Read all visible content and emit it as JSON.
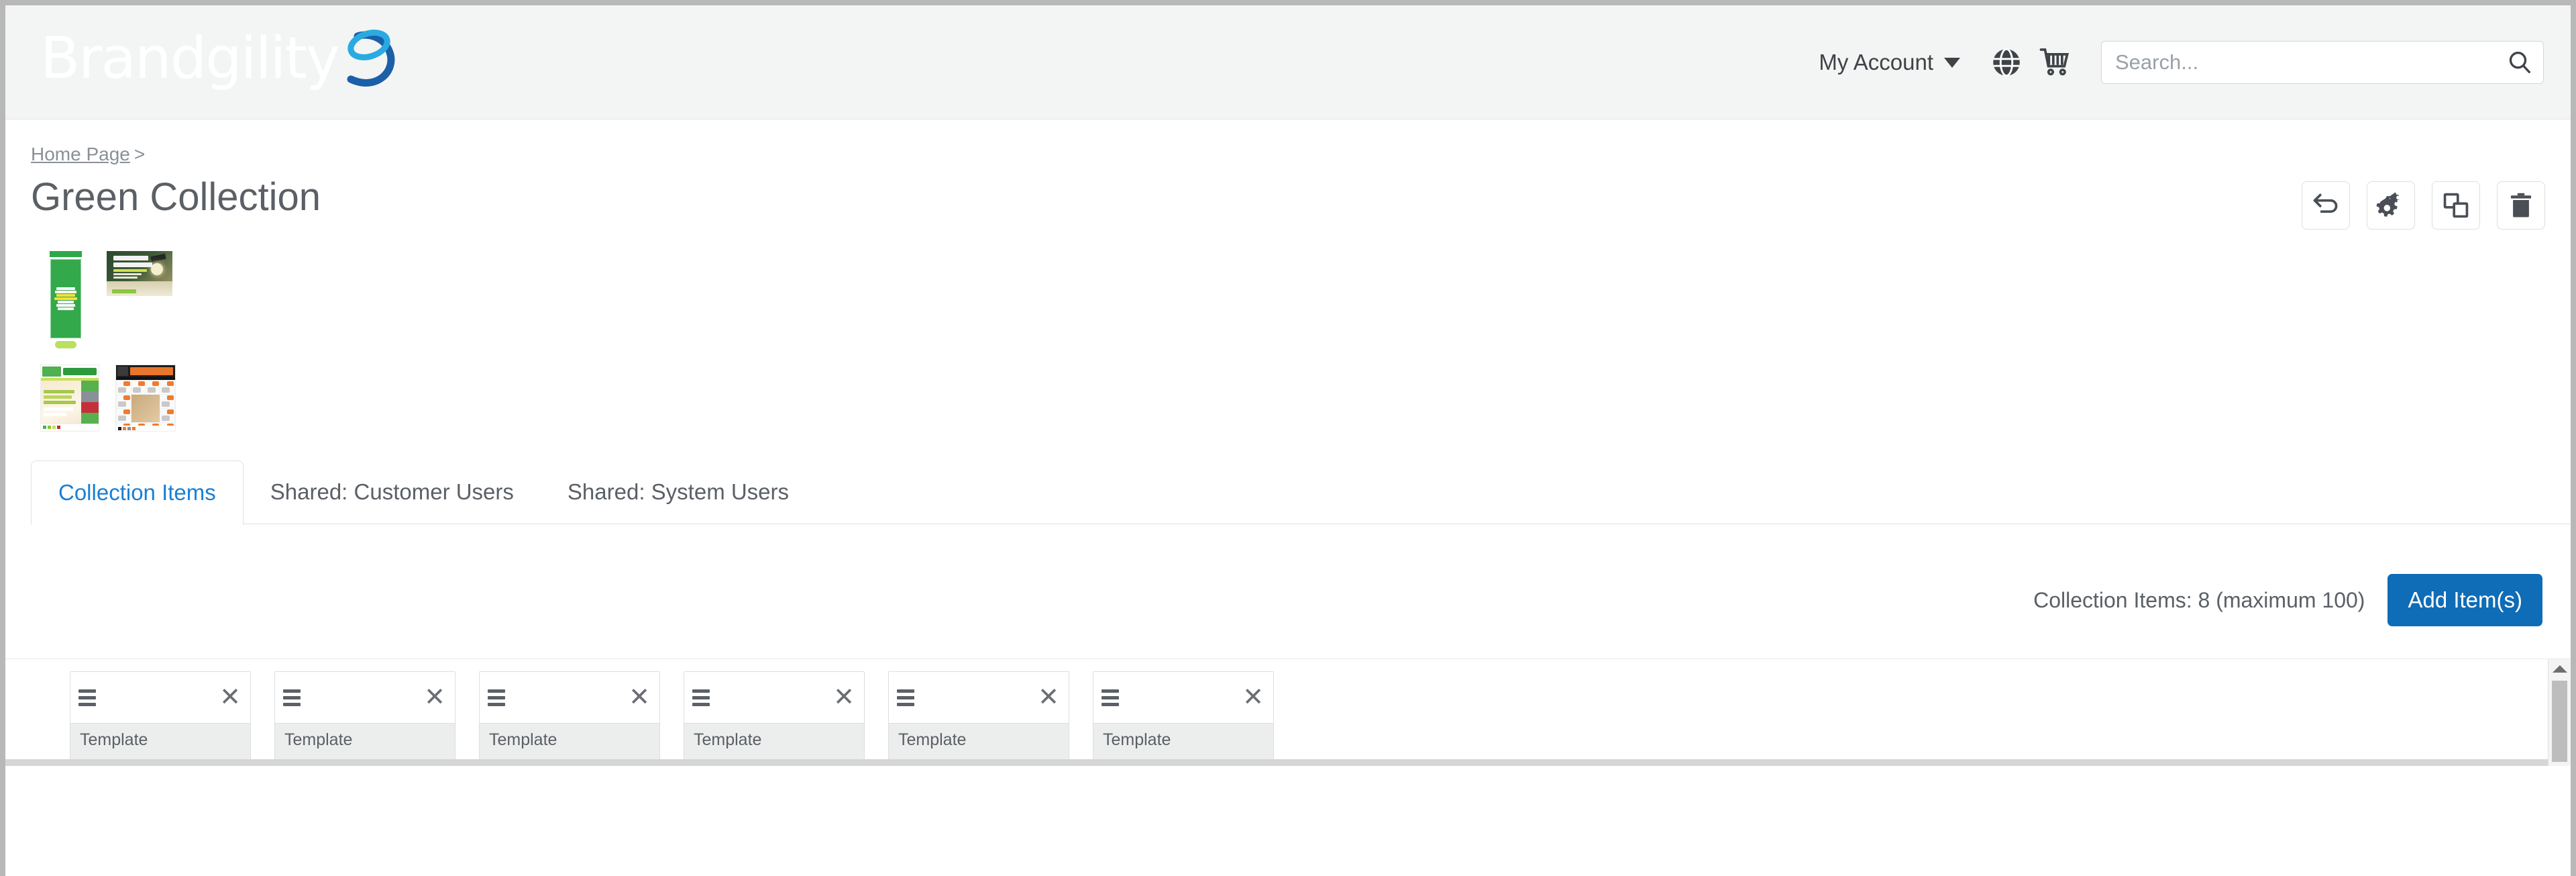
{
  "header": {
    "brand_name": "Brandgility",
    "brand_colors": {
      "swirl_light": "#29ABE2",
      "swirl_dark": "#1B5FA8",
      "wordmark": "#ffffff"
    },
    "background": "#f3f4f4",
    "my_account_label": "My Account",
    "caret_icon": "chevron-down-icon",
    "globe_icon": "globe-icon",
    "cart_icon": "shopping-cart-icon",
    "search": {
      "value": "",
      "placeholder": "Search...",
      "icon": "search-icon"
    }
  },
  "breadcrumb": {
    "items": [
      {
        "label": "Home Page",
        "link": true
      }
    ],
    "separator": ">"
  },
  "page": {
    "title": "Green Collection"
  },
  "actions": [
    {
      "name": "back-button",
      "icon": "undo-arrow-icon",
      "label": "Back"
    },
    {
      "name": "settings-button",
      "icon": "gears-icon",
      "label": "Settings"
    },
    {
      "name": "duplicate-button",
      "icon": "copy-icon",
      "label": "Duplicate"
    },
    {
      "name": "delete-button",
      "icon": "trash-icon",
      "label": "Delete"
    }
  ],
  "thumbnails": [
    {
      "name": "thumbnail-spring-banner",
      "alt": "Spring Colours Spring Flavours Year Round Value green banner",
      "lines": [
        "Spring",
        "Colours",
        "Spring",
        "Flavours",
        "Year",
        "Round",
        "Value"
      ]
    },
    {
      "name": "thumbnail-special-discount",
      "alt": "SPECIAL DISCOUNT University Band graduation advert",
      "lines": [
        "SPECIAL",
        "DISCOUNT",
        "UNIVERSITY BAND",
        "Switch now for a special graduate discount"
      ]
    },
    {
      "name": "thumbnail-goodacres-flyer",
      "alt": "Goodacre's grocery flyer - The Grocer 2020 Winner Retailer of the Year",
      "lines": [
        "Goodacre's",
        "THE GROCER 2020 WINNER",
        "Retailer of the Year"
      ]
    },
    {
      "name": "thumbnail-coretex-catalog",
      "alt": "CORETEX power tools catalogue",
      "lines": [
        "CORETEX",
        "CORE RANGE"
      ]
    }
  ],
  "tabs": [
    {
      "label": "Collection Items",
      "active": true
    },
    {
      "label": "Shared: Customer Users",
      "active": false
    },
    {
      "label": "Shared: System Users",
      "active": false
    }
  ],
  "items_toolbar": {
    "count_text": "Collection Items: 8 (maximum 100)",
    "count": 8,
    "maximum": 100,
    "add_button_label": "Add Item(s)",
    "add_button_color": "#0f6cb6"
  },
  "item_cards": [
    {
      "type_label": "Template",
      "drag_icon": "drag-handle-icon",
      "close_icon": "close-icon"
    },
    {
      "type_label": "Template",
      "drag_icon": "drag-handle-icon",
      "close_icon": "close-icon"
    },
    {
      "type_label": "Template",
      "drag_icon": "drag-handle-icon",
      "close_icon": "close-icon"
    },
    {
      "type_label": "Template",
      "drag_icon": "drag-handle-icon",
      "close_icon": "close-icon"
    },
    {
      "type_label": "Template",
      "drag_icon": "drag-handle-icon",
      "close_icon": "close-icon"
    },
    {
      "type_label": "Template",
      "drag_icon": "drag-handle-icon",
      "close_icon": "close-icon"
    }
  ],
  "scrollbars": {
    "vertical_present": true,
    "horizontal_present": true,
    "up_arrow_icon": "chevron-up-icon"
  }
}
